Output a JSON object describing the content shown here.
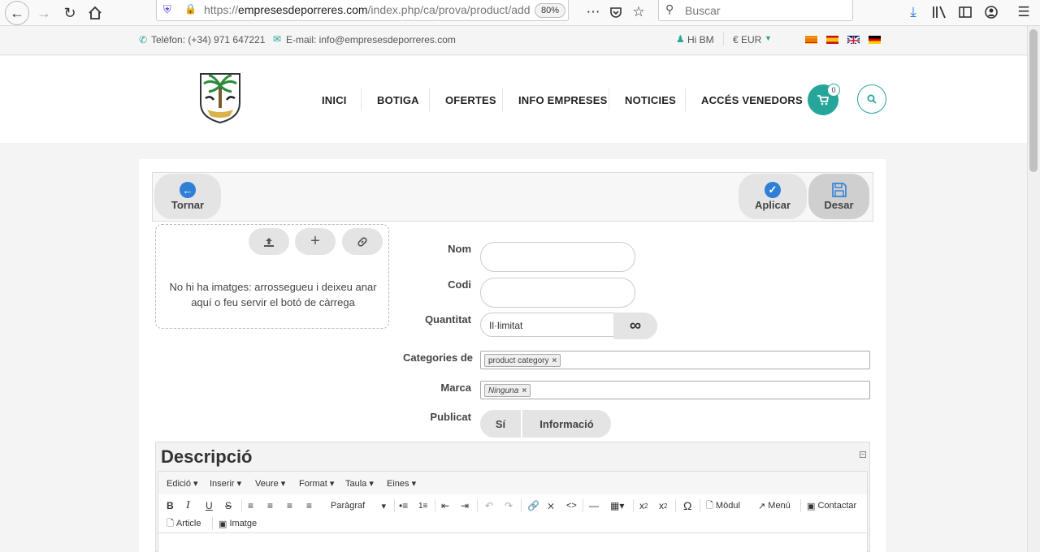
{
  "browser": {
    "url_prefix": "https://",
    "url_domain": "empresesdeporreres.com",
    "url_path": "/index.php/ca/prova/product/add",
    "zoom": "80%",
    "search_placeholder": "Buscar"
  },
  "infobar": {
    "phone": "Telèfon: (+34) 971 647221",
    "email": "E-mail: info@empresesdeporreres.com",
    "user": "Hi BM",
    "currency": "€ EUR"
  },
  "menu": {
    "items": [
      "INICI",
      "BOTIGA",
      "OFERTES",
      "INFO EMPRESES",
      "NOTICIES",
      "ACCÉS VENEDORS"
    ],
    "cart_count": "0"
  },
  "toolbar": {
    "back": "Tornar",
    "apply": "Aplicar",
    "save": "Desar"
  },
  "dropzone": {
    "text": "No hi ha imatges: arrossegueu i deixeu anar aquí o feu servir el botó de càrrega"
  },
  "form": {
    "name_label": "Nom",
    "code_label": "Codi",
    "quantity_label": "Quantitat",
    "quantity_value": "Il·limitat",
    "categories_label": "Categories de",
    "category_tag": "product category",
    "brand_label": "Marca",
    "brand_tag": "Ninguna",
    "published_label": "Publicat",
    "published_yes": "Sí",
    "published_info": "Informació"
  },
  "description": {
    "title": "Descripció",
    "menubar": [
      "Edició",
      "Inserir",
      "Veure",
      "Format",
      "Taula",
      "Eines"
    ],
    "paragraph": "Paràgraf",
    "module": "Mòdul",
    "menu_btn": "Menú",
    "contact": "Contactar",
    "article": "Article",
    "image": "Imatge"
  },
  "colors": {
    "accent": "#26a69a",
    "blue": "#2f7ed8"
  }
}
